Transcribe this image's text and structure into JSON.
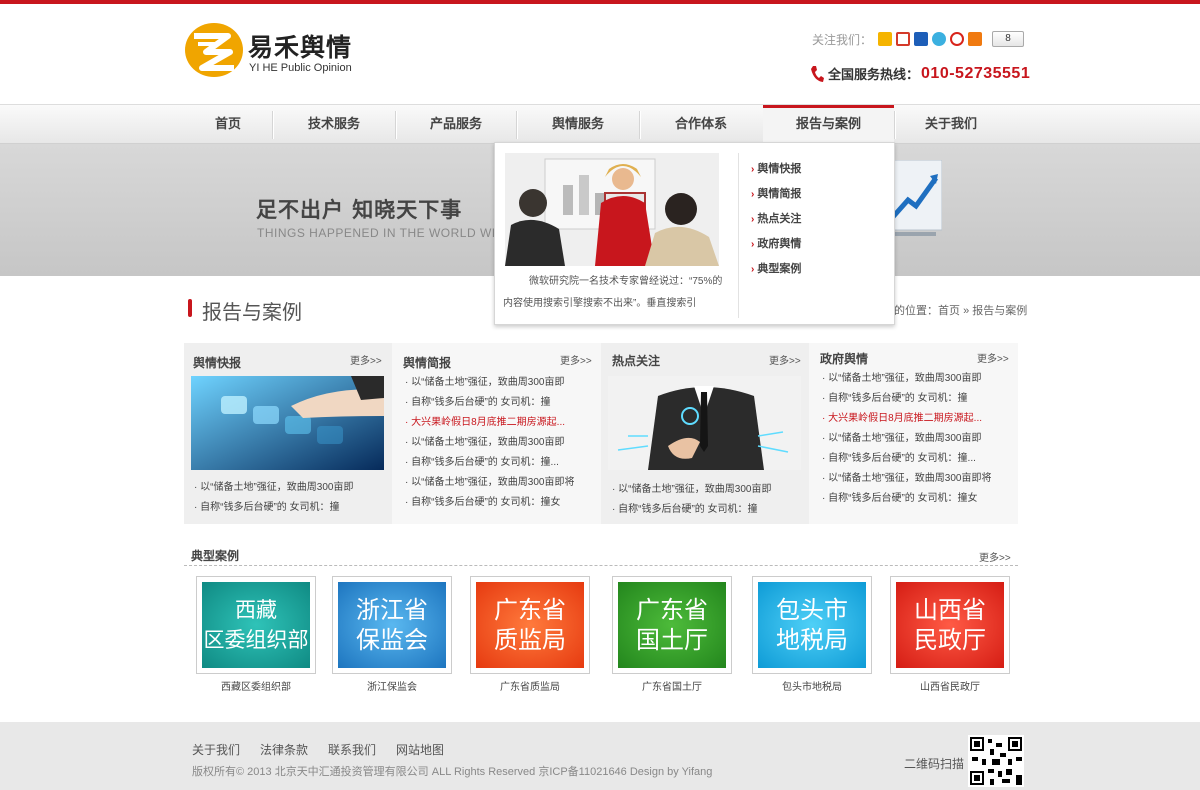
{
  "header": {
    "logo_cn": "易禾舆情",
    "logo_en": "YI HE Public Opinion",
    "follow_label": "关注我们：",
    "share_count": "8",
    "share_icons": [
      "sina-weibo-icon",
      "tencent-weibo-icon",
      "renren-icon",
      "qzone-icon",
      "netease-icon",
      "more-share-icon"
    ],
    "hotline_label": "全国服务热线：",
    "hotline_number": "010-52735551"
  },
  "nav": {
    "items": [
      {
        "label": "首页"
      },
      {
        "label": "技术服务"
      },
      {
        "label": "产品服务"
      },
      {
        "label": "舆情服务"
      },
      {
        "label": "合作体系"
      },
      {
        "label": "报告与案例"
      },
      {
        "label": "关于我们"
      }
    ],
    "active_index": 5
  },
  "banner": {
    "title": "足不出户 知晓天下事",
    "subtitle": "THINGS HAPPENED IN THE WORLD WITH"
  },
  "dropdown": {
    "desc": "微软研究院一名技术专家曾经说过：“75%的内容使用搜索引擎搜索不出来”。垂直搜索引",
    "links": [
      "舆情快报",
      "舆情简报",
      "热点关注",
      "政府舆情",
      "典型案例"
    ]
  },
  "page": {
    "title": "报告与案例",
    "breadcrumb_prefix": "的位置：",
    "breadcrumb_home": "首页",
    "breadcrumb_sep": "»",
    "breadcrumb_current": "报告与案例"
  },
  "columns": [
    {
      "title": "舆情快报",
      "more": "更多>>",
      "has_image": true,
      "items": [
        {
          "text": "· 以“储备土地”强征，致曲周300亩即",
          "hot": false
        },
        {
          "text": "· 自称“钱多后台硬”的 女司机：撞",
          "hot": false
        }
      ]
    },
    {
      "title": "舆情简报",
      "more": "更多>>",
      "has_image": false,
      "items": [
        {
          "text": "· 以“储备土地”强征，致曲周300亩即",
          "hot": false
        },
        {
          "text": "· 自称“钱多后台硬”的 女司机：撞",
          "hot": false
        },
        {
          "text": "· 大兴果岭假日8月底推二期房源起...",
          "hot": true
        },
        {
          "text": "· 以“储备土地”强征，致曲周300亩即",
          "hot": false
        },
        {
          "text": "· 自称“钱多后台硬”的 女司机：撞...",
          "hot": false
        },
        {
          "text": "· 以“储备土地”强征，致曲周300亩即将",
          "hot": false
        },
        {
          "text": "· 自称“钱多后台硬”的 女司机：撞女",
          "hot": false
        }
      ]
    },
    {
      "title": "热点关注",
      "more": "更多>>",
      "has_image": true,
      "items": [
        {
          "text": "· 以“储备土地”强征，致曲周300亩即",
          "hot": false
        },
        {
          "text": "· 自称“钱多后台硬”的 女司机：撞",
          "hot": false
        }
      ]
    },
    {
      "title": "政府舆情",
      "more": "更多>>",
      "has_image": false,
      "items": [
        {
          "text": "· 以“储备土地”强征，致曲周300亩即",
          "hot": false
        },
        {
          "text": "· 自称“钱多后台硬”的 女司机：撞",
          "hot": false
        },
        {
          "text": "· 大兴果岭假日8月底推二期房源起...",
          "hot": true
        },
        {
          "text": "· 以“储备土地”强征，致曲周300亩即",
          "hot": false
        },
        {
          "text": "· 自称“钱多后台硬”的 女司机：撞...",
          "hot": false
        },
        {
          "text": "· 以“储备土地”强征，致曲周300亩即将",
          "hot": false
        },
        {
          "text": "· 自称“钱多后台硬”的 女司机：撞女",
          "hot": false
        }
      ]
    }
  ],
  "cases": {
    "title": "典型案例",
    "more": "更多>>",
    "items": [
      {
        "line1": "西藏",
        "line2": "区委组织部",
        "caption": "西藏区委组织部",
        "color": "#1aa39a"
      },
      {
        "line1": "浙江省",
        "line2": "保监会",
        "caption": "浙江保监会",
        "color": "#2b8fd0"
      },
      {
        "line1": "广东省",
        "line2": "质监局",
        "caption": "广东省质监局",
        "color": "#f04d1a"
      },
      {
        "line1": "广东省",
        "line2": "国土厅",
        "caption": "广东省国土厅",
        "color": "#2f9a2a"
      },
      {
        "line1": "包头市",
        "line2": "地税局",
        "caption": "包头市地税局",
        "color": "#12a8e0"
      },
      {
        "line1": "山西省",
        "line2": "民政厅",
        "caption": "山西省民政厅",
        "color": "#e5291f"
      }
    ]
  },
  "footer": {
    "links": [
      "关于我们",
      "法律条款",
      "联系我们",
      "网站地图"
    ],
    "copyright": "版权所有© 2013 北京天中汇通投资管理有限公司 ALL Rights Reserved 京ICP备11021646 Design by Yifang",
    "qr_label": "二维码扫描"
  },
  "colors": {
    "brand_red": "#c8161d",
    "logo_gold": "#f0a500"
  }
}
